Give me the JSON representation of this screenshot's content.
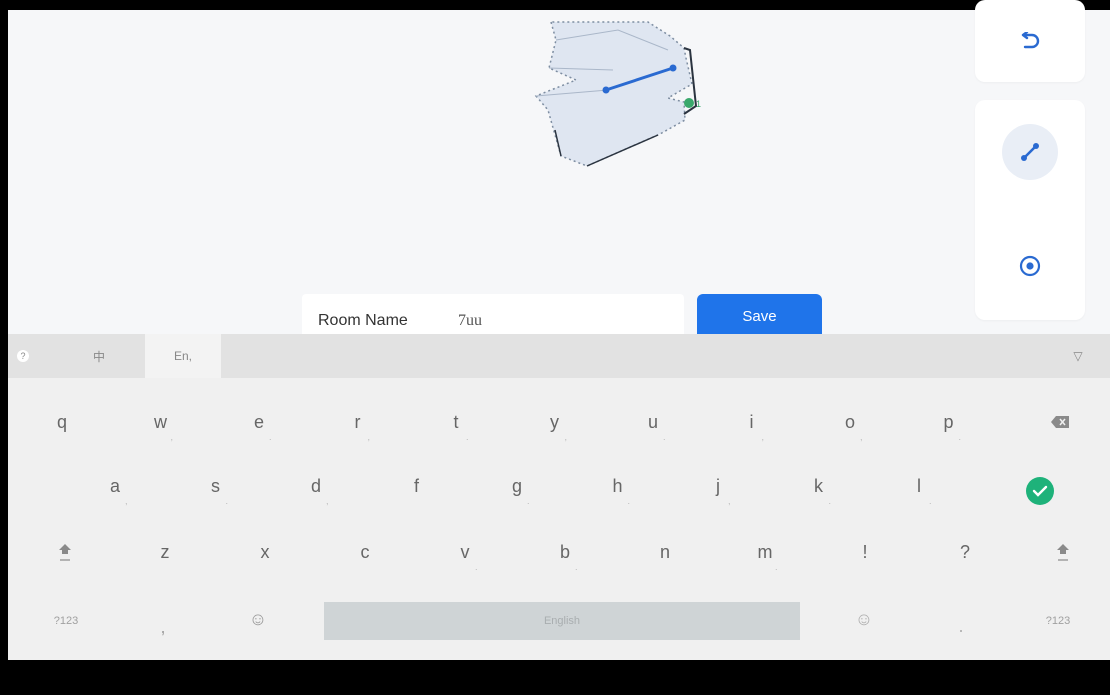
{
  "room_name": {
    "label": "Room Name",
    "value": "7uu"
  },
  "save_button": {
    "label": "Save"
  },
  "map_tools": {
    "undo_icon": "undo-icon",
    "tools": [
      {
        "name": "line-tool-icon",
        "active": true
      },
      {
        "name": "target-icon",
        "active": false
      }
    ],
    "marker_label": "1"
  },
  "keyboard": {
    "tabs": [
      {
        "label": "?",
        "icon": "help"
      },
      {
        "label": "中"
      },
      {
        "label": "En,"
      }
    ],
    "collapse_icon": "▽",
    "row1": [
      {
        "k": "q",
        "s": ""
      },
      {
        "k": "w",
        "s": ","
      },
      {
        "k": "e",
        "s": "."
      },
      {
        "k": "r",
        "s": ","
      },
      {
        "k": "t",
        "s": "."
      },
      {
        "k": "y",
        "s": ","
      },
      {
        "k": "u",
        "s": "."
      },
      {
        "k": "i",
        "s": ","
      },
      {
        "k": "o",
        "s": ","
      },
      {
        "k": "p",
        "s": "."
      }
    ],
    "row2": [
      {
        "k": "a",
        "s": ","
      },
      {
        "k": "s",
        "s": "."
      },
      {
        "k": "d",
        "s": ","
      },
      {
        "k": "f",
        "s": ""
      },
      {
        "k": "g",
        "s": "."
      },
      {
        "k": "h",
        "s": "."
      },
      {
        "k": "j",
        "s": ","
      },
      {
        "k": "k",
        "s": "."
      },
      {
        "k": "l",
        "s": "."
      }
    ],
    "row3": [
      {
        "k": "z",
        "s": ""
      },
      {
        "k": "x",
        "s": ""
      },
      {
        "k": "c",
        "s": ""
      },
      {
        "k": "v",
        "s": "."
      },
      {
        "k": "b",
        "s": "."
      },
      {
        "k": "n",
        "s": ""
      },
      {
        "k": "m",
        "s": "."
      },
      {
        "k": "!",
        "s": ""
      },
      {
        "k": "?",
        "s": ""
      }
    ],
    "bottom": {
      "left_mode": "?123",
      "comma": ",",
      "emoji": "☺",
      "space": "English",
      "period": ".",
      "right_mode": "?123"
    }
  },
  "colors": {
    "accent": "#1f74ea",
    "enter": "#1eb27a"
  }
}
